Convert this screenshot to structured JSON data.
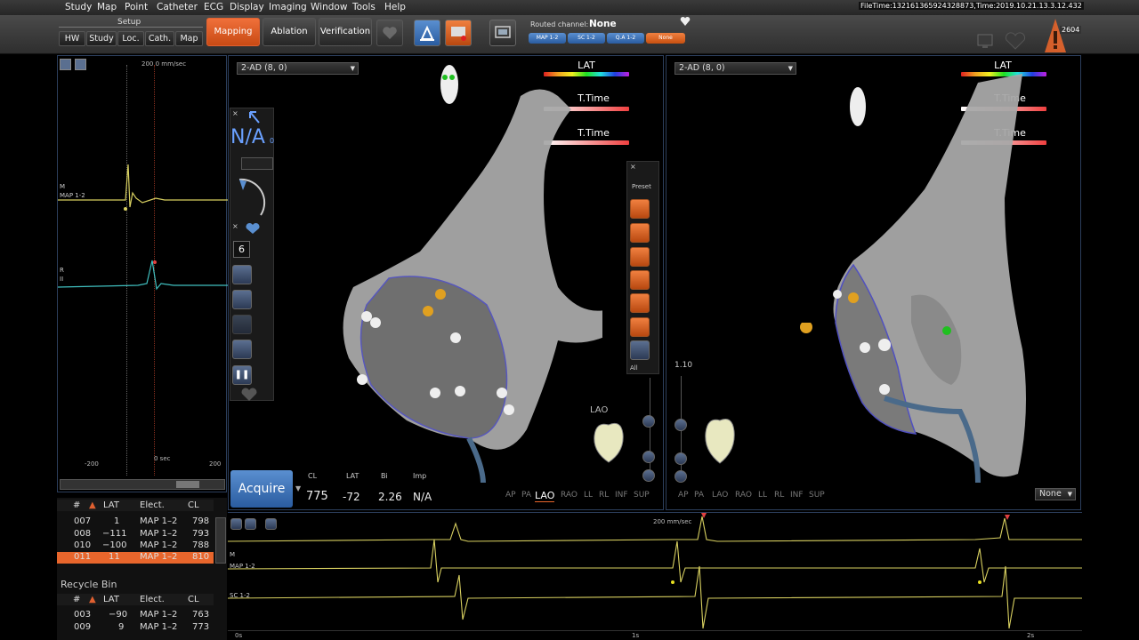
{
  "menu": [
    "Study",
    "Map",
    "Point",
    "Catheter",
    "ECG",
    "Display",
    "Imaging",
    "Window",
    "Tools",
    "Help"
  ],
  "file_info": "FileTime:132161365924328873,Time:2019.10.21.13.3.12.432",
  "toolbar": {
    "setup_label": "Setup",
    "setup_tabs": [
      "HW",
      "Study",
      "Loc.",
      "Cath.",
      "Map"
    ],
    "modes": {
      "mapping": "Mapping",
      "ablation": "Ablation",
      "verification": "Verification"
    },
    "routed_label": "Routed channel:",
    "routed_value": "None",
    "routed_pills": [
      "MAP 1-2",
      "SC 1-2",
      "Q.A 1-2",
      "None"
    ],
    "counter": "2604"
  },
  "ecg_panel": {
    "speed": "200.0 mm/sec",
    "m_label": "M",
    "map_label": "MAP 1-2",
    "r_label": "R",
    "ii_label": "II",
    "axis": [
      "-200",
      "0 sec",
      "200"
    ]
  },
  "points_table": {
    "headers": [
      "#",
      "LAT",
      "Elect.",
      "CL"
    ],
    "rows": [
      {
        "num": "007",
        "lat": "1",
        "elect": "MAP 1–2",
        "cl": "798"
      },
      {
        "num": "008",
        "lat": "−111",
        "elect": "MAP 1–2",
        "cl": "793"
      },
      {
        "num": "010",
        "lat": "−100",
        "elect": "MAP 1–2",
        "cl": "788"
      },
      {
        "num": "011",
        "lat": "11",
        "elect": "MAP 1–2",
        "cl": "810"
      }
    ]
  },
  "recycle_bin": {
    "title": "Recycle Bin",
    "headers": [
      "#",
      "LAT",
      "Elect.",
      "CL"
    ],
    "rows": [
      {
        "num": "003",
        "lat": "−90",
        "elect": "MAP 1–2",
        "cl": "763"
      },
      {
        "num": "009",
        "lat": "9",
        "elect": "MAP 1–2",
        "cl": "773"
      }
    ]
  },
  "left_map": {
    "view_select": "2-AD (8, 0)",
    "legend": [
      "LAT",
      "T.Time",
      "T.Time"
    ],
    "na_label": "N/A",
    "na_sub": "0",
    "number": "6",
    "preset_label": "Preset",
    "all_label": "All",
    "lao_label": "LAO",
    "views": [
      "AP",
      "PA",
      "LAO",
      "RAO",
      "LL",
      "RL",
      "INF",
      "SUP"
    ],
    "active_view": "LAO",
    "acquire": "Acquire",
    "readout_headers": [
      "CL",
      "LAT",
      "Bi",
      "Imp"
    ],
    "readout_values": [
      "775",
      "-72",
      "2.26",
      "N/A"
    ]
  },
  "right_map": {
    "view_select": "2-AD (8, 0)",
    "legend": [
      "LAT",
      "T.Time",
      "T.Time"
    ],
    "scale": "1.10",
    "views": [
      "AP",
      "PA",
      "LAO",
      "RAO",
      "LL",
      "RL",
      "INF",
      "SUP"
    ],
    "none_select": "None"
  },
  "bottom_ecg": {
    "speed": "200 mm/sec",
    "m_label": "M",
    "map_label": "MAP 1-2",
    "sc_label": "SC 1-2",
    "axis": [
      "0s",
      "1s",
      "2s"
    ]
  },
  "colors": {
    "accent": "#e8662c",
    "highlight_row": "#e8662c",
    "ecg_yellow": "#d8d060",
    "ecg_cyan": "#40c0c0",
    "mesh": "#a8a8a8"
  }
}
